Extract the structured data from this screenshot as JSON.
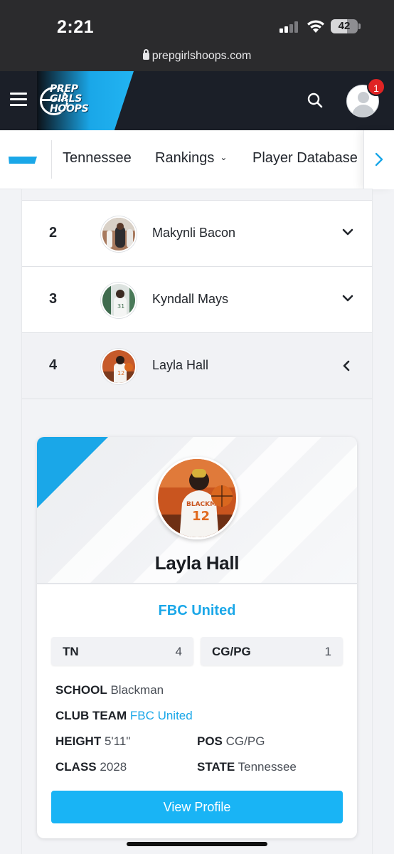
{
  "status_bar": {
    "time": "2:21",
    "battery": "42",
    "url": "prepgirlshoops.com"
  },
  "header": {
    "logo_lines": [
      "PREP",
      "GIRLS",
      "HOOPS"
    ],
    "notification_count": "1",
    "icons": [
      "menu-icon",
      "search-icon",
      "user-avatar-icon"
    ]
  },
  "subnav": {
    "items": [
      {
        "label": "Tennessee"
      },
      {
        "label": "Rankings",
        "caret": "⌄"
      },
      {
        "label": "Player Database"
      }
    ]
  },
  "rankings": [
    {
      "rank": "2",
      "name": "Makynli Bacon",
      "expanded": false
    },
    {
      "rank": "3",
      "name": "Kyndall Mays",
      "expanded": false
    },
    {
      "rank": "4",
      "name": "Layla Hall",
      "expanded": true
    }
  ],
  "player_card": {
    "name": "Layla Hall",
    "club": "FBC United",
    "stats": [
      {
        "label": "TN",
        "value": "4"
      },
      {
        "label": "CG/PG",
        "value": "1"
      }
    ],
    "details": {
      "school_label": "SCHOOL",
      "school": "Blackman",
      "club_team_label": "CLUB TEAM",
      "club_team": "FBC United",
      "height_label": "HEIGHT",
      "height": "5'11\"",
      "pos_label": "POS",
      "pos": "CG/PG",
      "class_label": "CLASS",
      "class": "2028",
      "state_label": "STATE",
      "state": "Tennessee"
    },
    "button": "View Profile"
  },
  "colors": {
    "accent": "#1aa7e8",
    "header_bg": "#1b1f28",
    "button": "#19b4f5",
    "badge": "#e02424"
  }
}
